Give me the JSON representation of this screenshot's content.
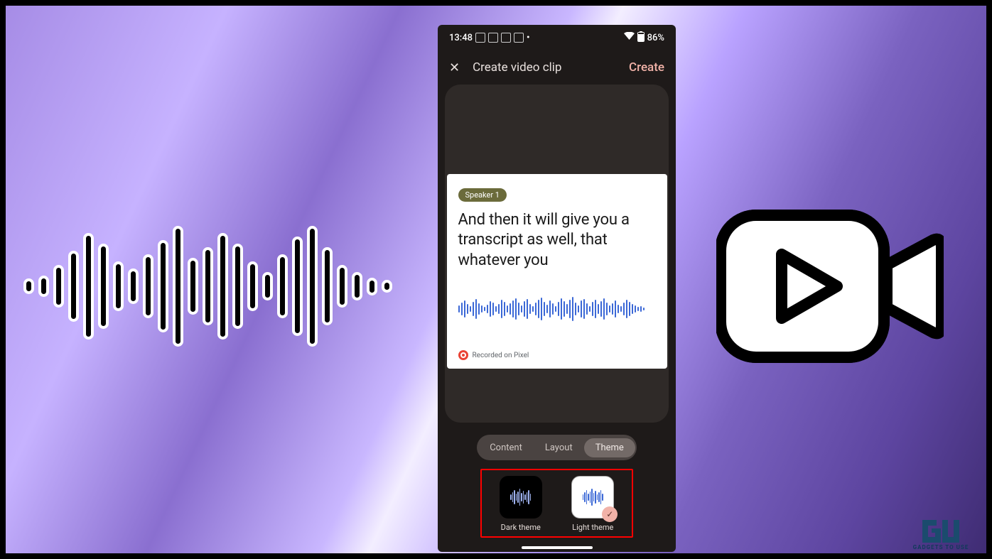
{
  "statusbar": {
    "time": "13:48",
    "battery": "86%"
  },
  "topbar": {
    "title": "Create video clip",
    "action": "Create"
  },
  "card": {
    "speaker_label": "Speaker 1",
    "transcript": "And then it will give you a transcript as well, that whatever you",
    "recorded_on": "Recorded on Pixel"
  },
  "tabs": {
    "items": [
      "Content",
      "Layout",
      "Theme"
    ],
    "active_index": 2
  },
  "themes": {
    "dark": {
      "label": "Dark theme",
      "selected": false
    },
    "light": {
      "label": "Light theme",
      "selected": true
    }
  },
  "watermark": {
    "tagline": "GADGETS TO USE"
  }
}
